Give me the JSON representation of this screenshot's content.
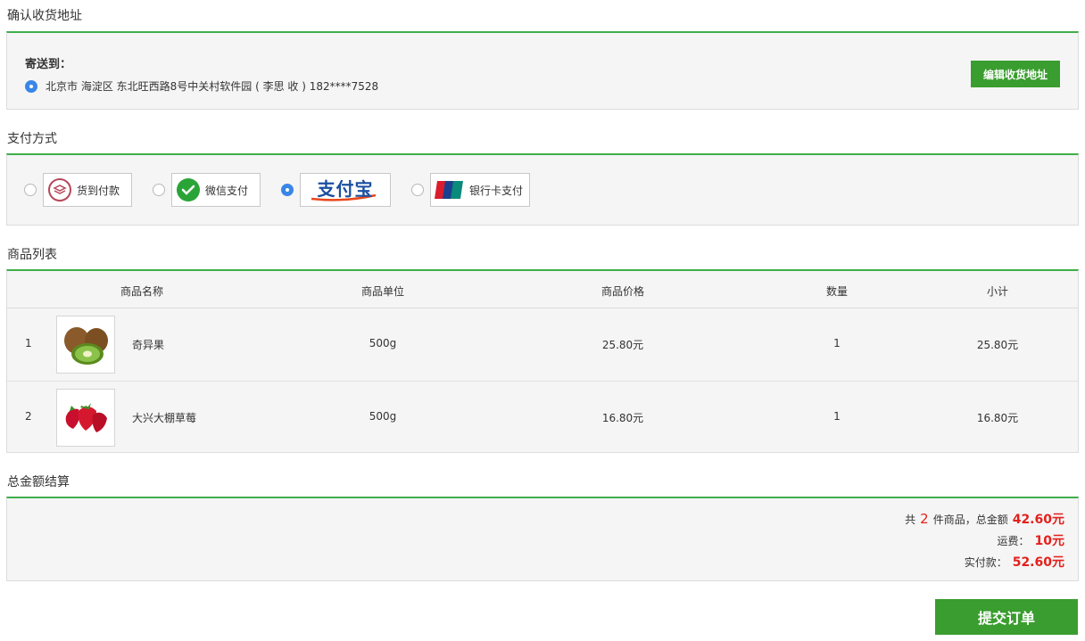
{
  "address": {
    "section_title": "确认收货地址",
    "send_to_label": "寄送到：",
    "address_text": "北京市 海淀区 东北旺西路8号中关村软件园 ( 李思 收 ) 182****7528",
    "edit_button": "编辑收货地址"
  },
  "payment": {
    "section_title": "支付方式",
    "options": [
      {
        "label": "货到付款",
        "selected": false,
        "icon": "cash-on-delivery-icon"
      },
      {
        "label": "微信支付",
        "selected": false,
        "icon": "wechat-icon"
      },
      {
        "label": "支付宝",
        "selected": true,
        "icon": "alipay-logo"
      },
      {
        "label": "银行卡支付",
        "selected": false,
        "icon": "unionpay-icon"
      }
    ]
  },
  "goods": {
    "section_title": "商品列表",
    "columns": [
      "商品名称",
      "商品单位",
      "商品价格",
      "数量",
      "小计"
    ],
    "rows": [
      {
        "index": "1",
        "name": "奇异果",
        "unit": "500g",
        "price": "25.80元",
        "qty": "1",
        "subtotal": "25.80元",
        "image": "kiwi-image"
      },
      {
        "index": "2",
        "name": "大兴大棚草莓",
        "unit": "500g",
        "price": "16.80元",
        "qty": "1",
        "subtotal": "16.80元",
        "image": "strawberry-image"
      }
    ]
  },
  "totals": {
    "section_title": "总金额结算",
    "count_prefix": "共",
    "count": "2",
    "count_suffix": "件商品，总金额",
    "total_amount": "42.60元",
    "shipping_label": "运费：",
    "shipping_amount": "10元",
    "pay_label": "实付款：",
    "pay_amount": "52.60元"
  },
  "submit_button": "提交订单",
  "colors": {
    "accent_green": "#3fae49",
    "button_green": "#3a9d2f",
    "price_red": "#e4201c",
    "radio_blue": "#3a86e8"
  }
}
